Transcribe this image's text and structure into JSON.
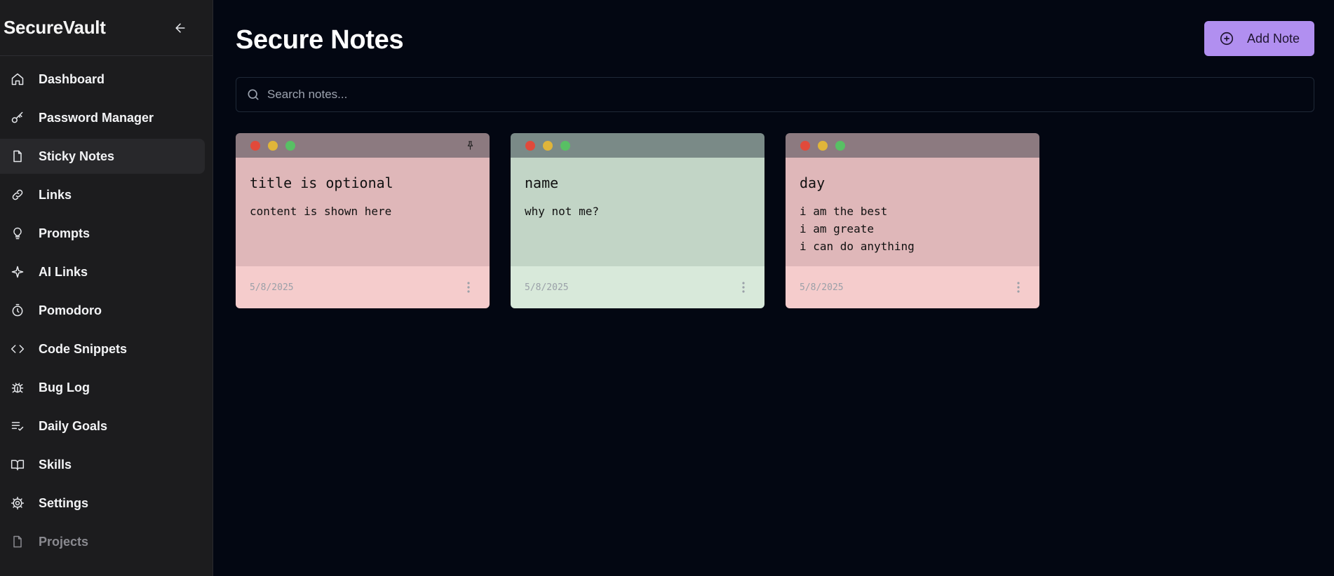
{
  "app": {
    "brand": "SecureVault"
  },
  "sidebar": {
    "items": [
      {
        "label": "Dashboard",
        "icon": "home-icon"
      },
      {
        "label": "Password Manager",
        "icon": "key-icon"
      },
      {
        "label": "Sticky Notes",
        "icon": "file-icon",
        "active": true
      },
      {
        "label": "Links",
        "icon": "link-icon"
      },
      {
        "label": "Prompts",
        "icon": "lightbulb-icon"
      },
      {
        "label": "AI Links",
        "icon": "sparkle-icon"
      },
      {
        "label": "Pomodoro",
        "icon": "timer-icon"
      },
      {
        "label": "Code Snippets",
        "icon": "code-icon"
      },
      {
        "label": "Bug Log",
        "icon": "bug-icon"
      },
      {
        "label": "Daily Goals",
        "icon": "list-check-icon"
      },
      {
        "label": "Skills",
        "icon": "book-icon"
      },
      {
        "label": "Settings",
        "icon": "gear-icon"
      },
      {
        "label": "Projects",
        "icon": "file-icon"
      }
    ]
  },
  "main": {
    "title": "Secure Notes",
    "add_button": "Add Note",
    "search": {
      "placeholder": "Search notes...",
      "value": ""
    },
    "notes": [
      {
        "title": "title is optional",
        "content": "content is shown here",
        "date": "5/8/2025",
        "color": "pink",
        "pinned": true
      },
      {
        "title": "name",
        "content": "why not me?",
        "date": "5/8/2025",
        "color": "green",
        "pinned": false
      },
      {
        "title": "day",
        "content": "i am the best\ni am greate\ni can do anything",
        "date": "5/8/2025",
        "color": "pink",
        "pinned": false
      }
    ]
  },
  "colors": {
    "background": "#030712",
    "sidebar": "#1c1c1e",
    "accent": "#b18ff0"
  }
}
